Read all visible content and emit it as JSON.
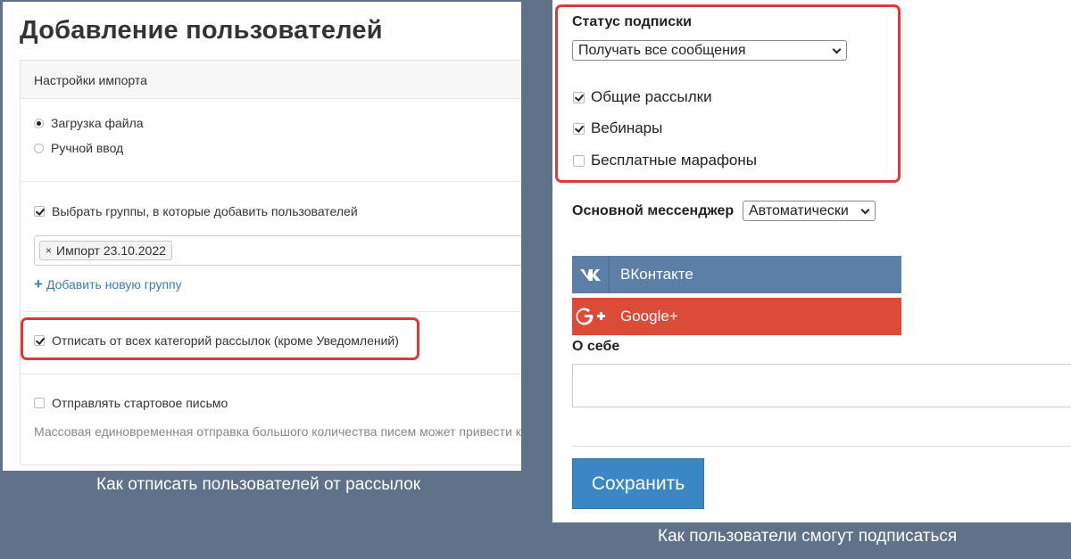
{
  "left": {
    "title": "Добавление пользователей",
    "import_header": "Настройки импорта",
    "source_options": [
      {
        "label": "Загрузка файла",
        "checked": true
      },
      {
        "label": "Ручной ввод",
        "checked": false
      }
    ],
    "choose_groups": {
      "label": "Выбрать группы, в которые добавить пользователей",
      "checked": true
    },
    "group_tag": {
      "remove": "×",
      "label": "Импорт 23.10.2022"
    },
    "add_group": {
      "icon": "+",
      "label": "Добавить новую группу"
    },
    "unsubscribe": {
      "label": "Отписать от всех категорий рассылок (кроме Уведомлений)",
      "checked": true
    },
    "welcome_letter": {
      "label": "Отправлять стартовое письмо",
      "checked": false
    },
    "hint": "Массовая единовременная отправка большого количества писем может привести к"
  },
  "left_caption": "Как отписать пользователей от рассылок",
  "right": {
    "subscription_status_label": "Статус подписки",
    "subscription_select": "Получать все сообщения",
    "categories": [
      {
        "label": "Общие рассылки",
        "checked": true
      },
      {
        "label": "Вебинары",
        "checked": true
      },
      {
        "label": "Бесплатные марафоны",
        "checked": false
      }
    ],
    "messenger_label": "Основной мессенджер",
    "messenger_select": "Автоматически",
    "vk_button": "ВКонтакте",
    "google_button": "Google+",
    "about_label": "О себе",
    "save_button": "Сохранить"
  },
  "right_caption": "Как пользователи смогут подписаться",
  "colors": {
    "background": "#5f728a",
    "highlight": "#d93a3a",
    "vk": "#5b7fa6",
    "google": "#dc4a38",
    "save": "#3b86c4",
    "link": "#3a7bbf"
  }
}
